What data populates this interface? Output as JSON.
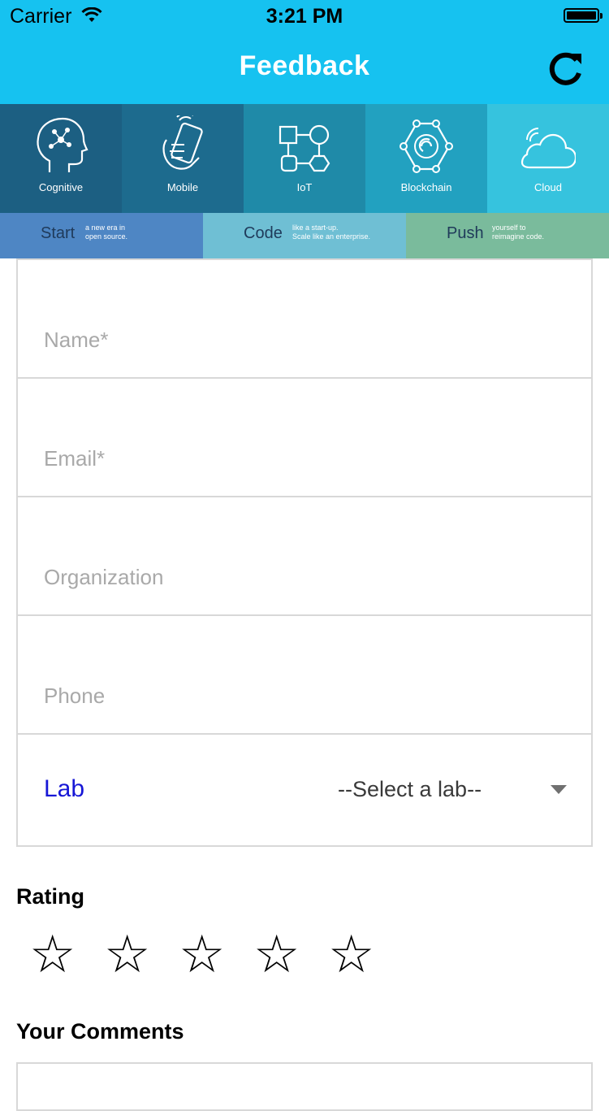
{
  "status_bar": {
    "carrier": "Carrier",
    "time": "3:21 PM"
  },
  "header": {
    "title": "Feedback",
    "refresh_icon": "refresh-icon"
  },
  "categories": [
    {
      "label": "Cognitive",
      "icon": "head-network-icon",
      "color": "#1c5f82"
    },
    {
      "label": "Mobile",
      "icon": "phone-in-hand-icon",
      "color": "#1d6b8e"
    },
    {
      "label": "IoT",
      "icon": "connected-shapes-icon",
      "color": "#1f8aa8"
    },
    {
      "label": "Blockchain",
      "icon": "hexagon-chain-icon",
      "color": "#22a1c0"
    },
    {
      "label": "Cloud",
      "icon": "cloud-icon",
      "color": "#36c3de"
    }
  ],
  "taglines": [
    {
      "big": "Start",
      "small1": "a new era in",
      "small2": "open source.",
      "color": "#4e86c4"
    },
    {
      "big": "Code",
      "small1": "like a start-up.",
      "small2": "Scale like an enterprise.",
      "color": "#6fbfd4"
    },
    {
      "big": "Push",
      "small1": "yourself to",
      "small2": "reimagine code.",
      "color": "#7abb9c"
    }
  ],
  "form": {
    "name_placeholder": "Name*",
    "email_placeholder": "Email*",
    "organization_placeholder": "Organization",
    "phone_placeholder": "Phone",
    "lab_label": "Lab",
    "lab_selected": "--Select a lab--"
  },
  "rating": {
    "title": "Rating",
    "value": 0,
    "max": 5,
    "star_glyph": "☆"
  },
  "comments": {
    "title": "Your Comments"
  }
}
